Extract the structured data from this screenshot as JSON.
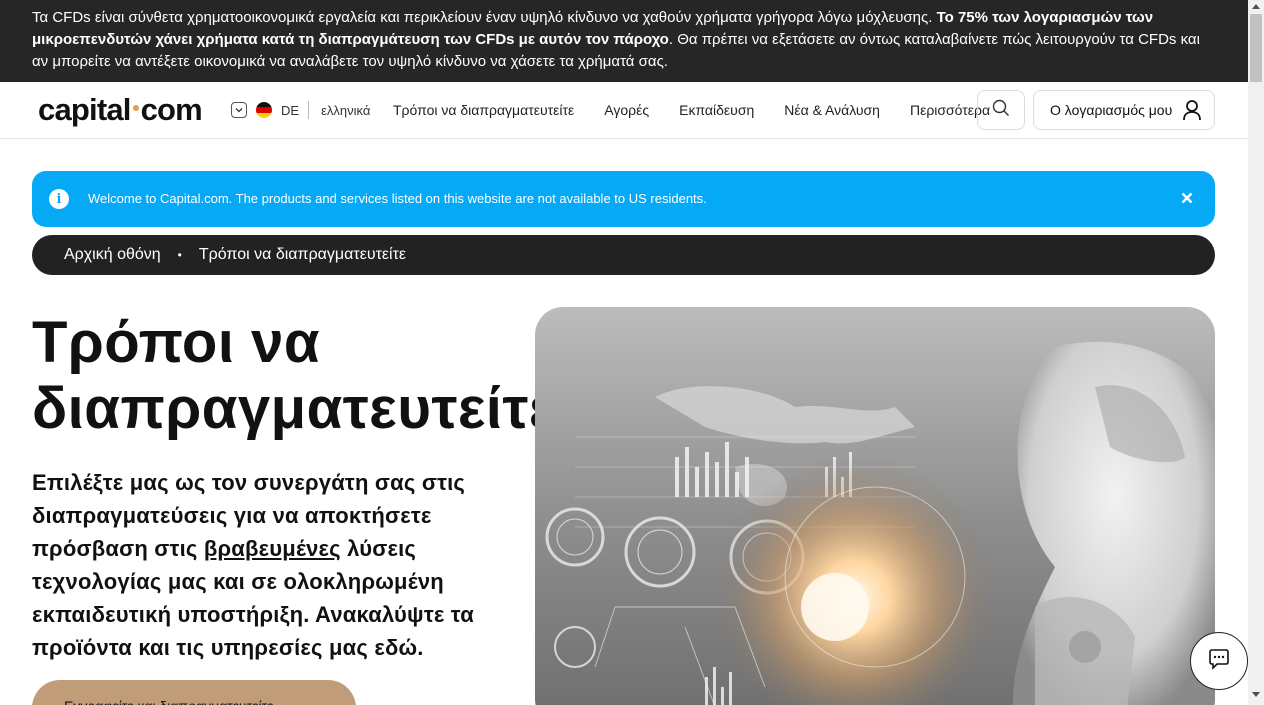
{
  "risk_warning": {
    "part1": "Τα CFDs είναι σύνθετα χρηματοοικονομικά εργαλεία και περικλείουν έναν υψηλό κίνδυνο να χαθούν χρήματα γρήγορα λόγω μόχλευσης. ",
    "bold": "Το 75% των λογαριασμών των μικροεπενδυτών χάνει χρήματα κατά τη διαπραγμάτευση των CFDs με αυτόν τον πάροχο",
    "part2": ". Θα πρέπει να εξετάσετε αν όντως καταλαβαίνετε πώς λειτουργούν τα CFDs και αν μπορείτε να αντέξετε οικονομικά να αναλάβετε τον υψηλό κίνδυνο να χάσετε τα χρήματά σας."
  },
  "header": {
    "logo_left": "capital",
    "logo_right": "com",
    "region_code": "DE",
    "language": "ελληνικά",
    "nav": [
      "Τρόποι να διαπραγματευτείτε",
      "Αγορές",
      "Εκπαίδευση",
      "Νέα & Ανάλυση",
      "Περισσότερα"
    ],
    "account_label": "Ο λογαριασμός μου"
  },
  "notice": {
    "message": "Welcome to Capital.com. The products and services listed on this website are not available to US residents."
  },
  "breadcrumb": {
    "home": "Αρχική οθόνη",
    "current": "Τρόποι να διαπραγματευτείτε"
  },
  "hero": {
    "title_line1": "Τρόποι να",
    "title_line2": "διαπραγματευτείτε",
    "desc_before": "Επιλέξτε μας ως τον συνεργάτη σας στις διαπραγματεύσεις για να αποκτήσετε πρόσβαση στις ",
    "desc_link": "βραβευμένες",
    "desc_after": " λύσεις τεχνολογίας μας και σε ολοκληρωμένη εκπαιδευτική υποστήριξη. Ανακαλύψτε τα προϊόντα και τις υπηρεσίες μας εδώ.",
    "cta_label": "Εγγραφείτε και διαπραγματευτείτε"
  },
  "colors": {
    "risk_banner_bg": "#262626",
    "notice_bg": "#05a9f5",
    "breadcrumb_bg": "#222222",
    "cta_bg": "#c09c78",
    "logo_dot": "#e49c58"
  },
  "icons": {
    "language_toggle": "chevron-down-icon",
    "flag": "germany-flag-icon",
    "search": "search-icon",
    "account": "user-icon",
    "info": "info-icon",
    "close": "close-icon",
    "chat": "chat-icon"
  }
}
